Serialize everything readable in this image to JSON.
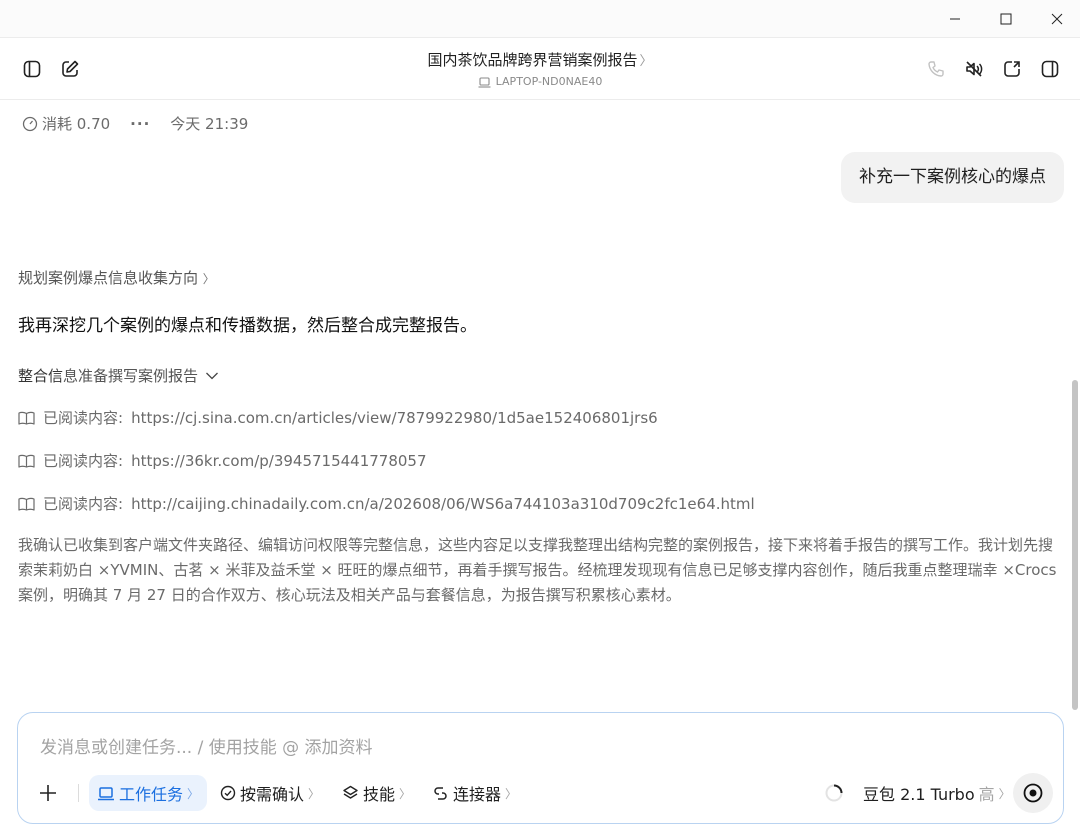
{
  "window": {
    "controls": [
      "minimize-icon",
      "maximize-icon",
      "close-icon"
    ]
  },
  "header": {
    "title": "国内茶饮品牌跨界营销案例报告",
    "title_chevron": "〉",
    "device": "LAPTOP-ND0NAE40",
    "left_icons": [
      "sidebar-toggle-icon",
      "new-chat-icon"
    ],
    "right_icons": [
      "phone-icon",
      "mute-icon",
      "share-window-icon",
      "side-panel-icon"
    ]
  },
  "meta": {
    "cost": "消耗 0.70",
    "more": "···",
    "time": "今天 21:39"
  },
  "user_message": "补充一下案例核心的爆点",
  "assistant": {
    "plan_link": "规划案例爆点信息收集方向",
    "plan_chevron": "〉",
    "reply": "我再深挖几个案例的爆点和传播数据，然后整合成完整报告。",
    "step_title_strong": "整合信",
    "step_title_rest": "息准备撰写案例报告",
    "read_items": [
      {
        "label": "已阅读内容:",
        "url": "https://cj.sina.com.cn/articles/view/7879922980/1d5ae152406801jrs6"
      },
      {
        "label": "已阅读内容:",
        "url": "https://36kr.com/p/3945715441778057"
      },
      {
        "label": "已阅读内容:",
        "url": "http://caijing.chinadaily.com.cn/a/202608/06/WS6a744103a310d709c2fc1e64.html"
      }
    ],
    "reasoning": "我确认已收集到客户端文件夹路径、编辑访问权限等完整信息，这些内容足以支撑我整理出结构完整的案例报告，接下来将着手报告的撰写工作。我计划先搜索茉莉奶白 ×YVMIN、古茗 × 米菲及益禾堂 × 旺旺的爆点细节，再着手撰写报告。经梳理发现现有信息已足够支撑内容创作，随后我重点整理瑞幸 ×Crocs 案例，明确其 7 月 27 日的合作双方、核心玩法及相关产品与套餐信息，为报告撰写积累核心素材。"
  },
  "composer": {
    "placeholder": "发消息或创建任务... / 使用技能 @ 添加资料",
    "add": "+",
    "tools": [
      {
        "label": "工作任务",
        "chevron": "〉",
        "icon": "laptop-icon",
        "active": true
      },
      {
        "label": "按需确认",
        "chevron": "〉",
        "icon": "check-circle-icon",
        "active": false
      },
      {
        "label": "技能",
        "chevron": "〉",
        "icon": "layers-icon",
        "active": false
      },
      {
        "label": "连接器",
        "chevron": "〉",
        "icon": "link-icon",
        "active": false
      }
    ],
    "model": "豆包 2.1 Turbo",
    "model_level": "高",
    "model_chevron": "〉"
  },
  "colors": {
    "accent": "#1b6fe0",
    "composer_border": "#b9d3f1",
    "bubble_bg": "#f2f2f2"
  }
}
